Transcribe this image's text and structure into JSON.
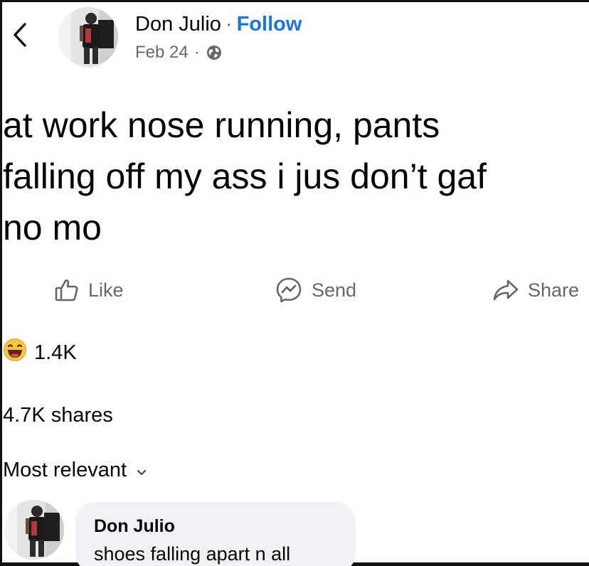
{
  "header": {
    "back_icon": "chevron-left-icon",
    "author": "Don Julio",
    "separator": "·",
    "follow_label": "Follow",
    "date": "Feb 24",
    "meta_separator": "·",
    "privacy_icon": "globe-icon"
  },
  "post": {
    "text": "at work nose running, pants\nfalling off my ass i jus don’t gaf\nno mo"
  },
  "actions": {
    "like_label": "Like",
    "like_icon": "thumbs-up-icon",
    "send_label": "Send",
    "send_icon": "messenger-icon",
    "share_label": "Share",
    "share_icon": "share-arrow-icon"
  },
  "reactions": {
    "icon": "haha-emoji-icon",
    "count": "1.4K"
  },
  "shares": {
    "label": "4.7K shares"
  },
  "comments": {
    "sort_label": "Most relevant",
    "sort_icon": "chevron-down-icon",
    "items": [
      {
        "author": "Don Julio",
        "text": "shoes falling apart n all"
      }
    ]
  },
  "colors": {
    "link": "#1b74e4",
    "secondary_text": "#65676b",
    "bubble": "#f0f2f5",
    "text": "#050505"
  }
}
